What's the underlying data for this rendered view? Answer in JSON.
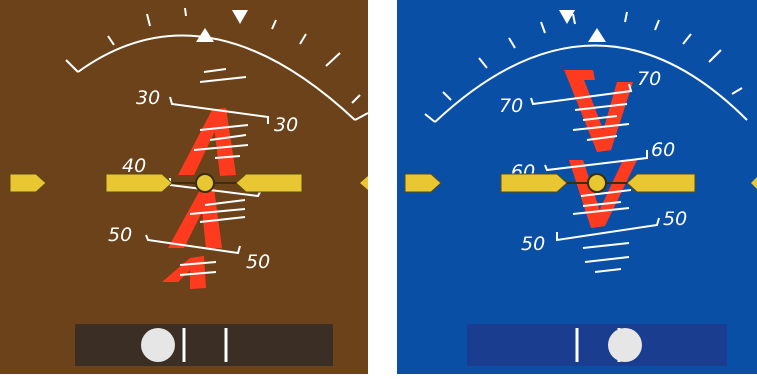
{
  "displays": [
    {
      "id": "left",
      "sky_color": "#6b4219",
      "chevron_color": "#ff3b1f",
      "chevron_direction": "up",
      "rail_color": "#3a2e25",
      "pitch_labels": [
        "30",
        "40",
        "50"
      ],
      "labels_right": [
        "30",
        "50"
      ],
      "ball_position": "left-of-center"
    },
    {
      "id": "right",
      "sky_color": "#0a4fa6",
      "chevron_color": "#ff3b1f",
      "chevron_direction": "down",
      "rail_color": "#1a3d8f",
      "pitch_labels": [
        "70",
        "60",
        "50"
      ],
      "labels_right": [
        "70",
        "60",
        "50"
      ],
      "ball_position": "right-of-center"
    }
  ],
  "colors": {
    "wing": "#e8c732",
    "wing_shadow": "#8a7413",
    "scale": "#ffffff",
    "ball": "#e6e6e6"
  },
  "icons": [
    "aircraft-symbol-icon",
    "bank-pointer-icon",
    "sky-pointer-icon",
    "slip-ball-icon"
  ]
}
